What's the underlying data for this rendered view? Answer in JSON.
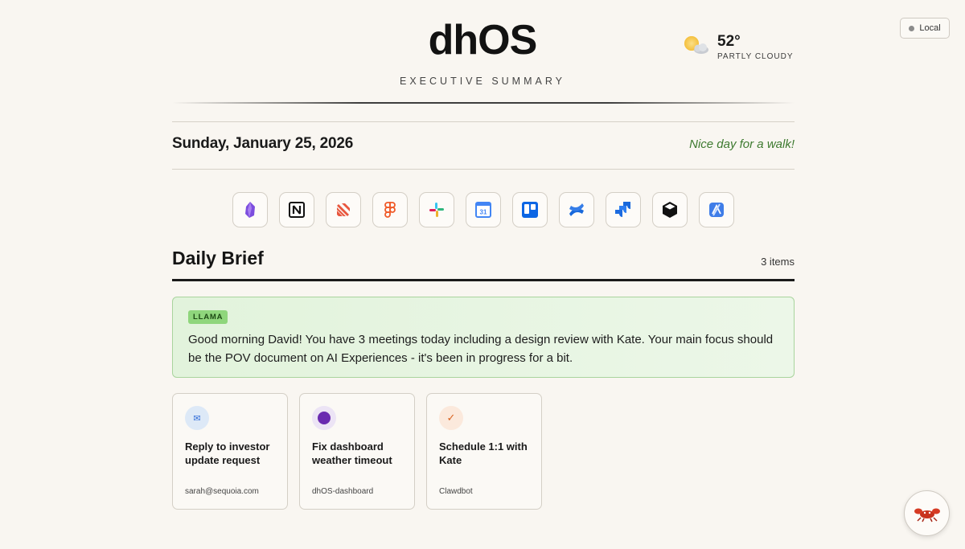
{
  "header": {
    "title": "dhOS",
    "subtitle": "EXECUTIVE SUMMARY",
    "mode_badge": "Local"
  },
  "weather": {
    "temperature": "52°",
    "condition": "PARTLY CLOUDY",
    "icon": "partly-cloudy-icon"
  },
  "date_row": {
    "date": "Sunday, January 25, 2026",
    "note": "Nice day for a walk!"
  },
  "apps": [
    {
      "name": "obsidian",
      "icon": "obsidian-icon",
      "color": "#7c4dde"
    },
    {
      "name": "notion",
      "icon": "notion-icon",
      "color": "#111111"
    },
    {
      "name": "linear",
      "icon": "linear-icon",
      "color": "#e8573e"
    },
    {
      "name": "figma",
      "icon": "figma-icon",
      "color": "#f05a28"
    },
    {
      "name": "slack",
      "icon": "slack-icon",
      "color": "#e01e5a"
    },
    {
      "name": "google-calendar",
      "icon": "calendar-icon",
      "color": "#4285f4"
    },
    {
      "name": "trello",
      "icon": "trello-icon",
      "color": "#0c66e4"
    },
    {
      "name": "confluence",
      "icon": "confluence-icon",
      "color": "#1868db"
    },
    {
      "name": "jira",
      "icon": "jira-icon",
      "color": "#1868db"
    },
    {
      "name": "box",
      "icon": "cube-icon",
      "color": "#111111"
    },
    {
      "name": "xcode",
      "icon": "xcode-icon",
      "color": "#3f7de8"
    }
  ],
  "calendar_day": "31",
  "brief": {
    "title": "Daily Brief",
    "count": "3 items",
    "llm_tag": "LLAMA",
    "summary": "Good morning David! You have 3 meetings today including a design review with Kate. Your main focus should be the POV document on AI Experiences - it's been in progress for a bit."
  },
  "tasks": [
    {
      "title": "Reply to investor update request",
      "source": "sarah@sequoia.com",
      "icon": "mail-icon",
      "icon_glyph": "✉",
      "icon_bg": "#dde9f7",
      "icon_color": "#2f6bd8"
    },
    {
      "title": "Fix dashboard weather timeout",
      "source": "dhOS-dashboard",
      "icon": "purple-dot-icon",
      "icon_glyph": "",
      "icon_bg": "#ece4f5",
      "icon_color": "#6a2ab0"
    },
    {
      "title": "Schedule 1:1 with Kate",
      "source": "Clawdbot",
      "icon": "checkmark-icon",
      "icon_glyph": "✓",
      "icon_bg": "#fbe9dc",
      "icon_color": "#d9621f"
    }
  ],
  "assistant": {
    "icon": "lobster-icon"
  }
}
